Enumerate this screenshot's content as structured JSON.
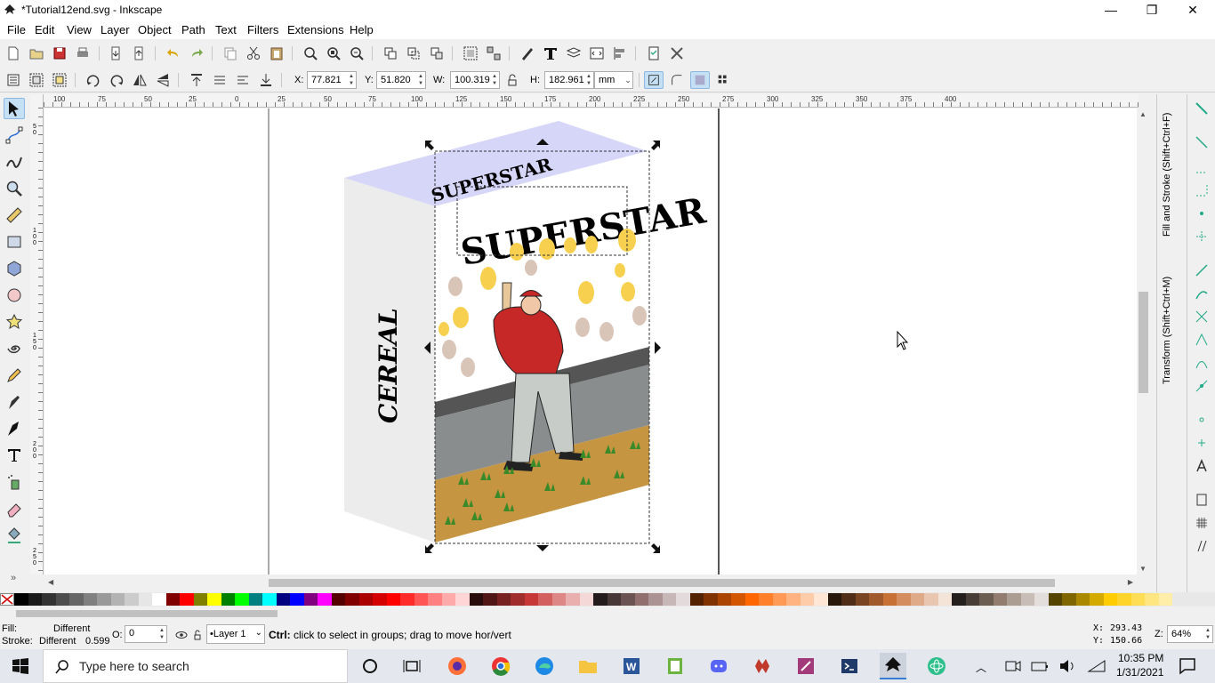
{
  "window": {
    "title": "*Tutorial12end.svg - Inkscape",
    "controls": {
      "minimize": "—",
      "maximize": "❐",
      "close": "✕"
    }
  },
  "menu": [
    "File",
    "Edit",
    "View",
    "Layer",
    "Object",
    "Path",
    "Text",
    "Filters",
    "Extensions",
    "Help"
  ],
  "transform": {
    "x_label": "X:",
    "x": "77.821",
    "y_label": "Y:",
    "y": "51.820",
    "w_label": "W:",
    "w": "100.319",
    "h_label": "H:",
    "h": "182.961",
    "unit": "mm"
  },
  "ruler": {
    "top_labels": [
      "100",
      "75",
      "50",
      "25",
      "0",
      "25",
      "50",
      "75",
      "100",
      "125",
      "150",
      "175",
      "200",
      "225",
      "250",
      "275",
      "300",
      "325",
      "350",
      "375",
      "400"
    ],
    "left_labels": [
      "50",
      "100",
      "150",
      "200",
      "250"
    ]
  },
  "artwork": {
    "box_top_text": "SUPERSTAR",
    "front_title": "SUPERSTAR",
    "side_text": "CEREAL"
  },
  "dock": {
    "fill_stroke_tab": "Fill and Stroke (Shift+Ctrl+F)",
    "transform_tab": "Transform (Shift+Ctrl+M)"
  },
  "palette": {
    "swatches": [
      "#000000",
      "#1a1a1a",
      "#333333",
      "#4d4d4d",
      "#666666",
      "#808080",
      "#999999",
      "#b3b3b3",
      "#cccccc",
      "#e6e6e6",
      "#ffffff",
      "#800000",
      "#ff0000",
      "#808000",
      "#ffff00",
      "#008000",
      "#00ff00",
      "#008080",
      "#00ffff",
      "#000080",
      "#0000ff",
      "#800080",
      "#ff00ff",
      "#550000",
      "#800000",
      "#aa0000",
      "#d40000",
      "#ff0000",
      "#ff2a2a",
      "#ff5555",
      "#ff8080",
      "#ffaaaa",
      "#ffd5d5",
      "#280b0b",
      "#501616",
      "#782121",
      "#a02c2c",
      "#c83737",
      "#d35f5f",
      "#de8787",
      "#e9afaf",
      "#f4d7d7",
      "#241c1c",
      "#483737",
      "#6c5353",
      "#916f6f",
      "#ac9393",
      "#c8b7b7",
      "#e3dbdb",
      "#552200",
      "#803300",
      "#aa4400",
      "#d45500",
      "#ff6600",
      "#ff7f2a",
      "#ff9955",
      "#ffb380",
      "#ffccaa",
      "#ffe6d5",
      "#28170b",
      "#502d16",
      "#784421",
      "#a05a2c",
      "#c87137",
      "#d38d5f",
      "#deaa87",
      "#e9c6af",
      "#f4e3d7",
      "#241f1c",
      "#483e37",
      "#6c5d53",
      "#917c6f",
      "#ac9d93",
      "#c8beb7",
      "#e3dedb",
      "#554400",
      "#806600",
      "#aa8800",
      "#d4aa00",
      "#ffcc00",
      "#ffd42a",
      "#ffdd55",
      "#ffe680",
      "#ffeeaa"
    ]
  },
  "status": {
    "fill_label": "Fill:",
    "fill_value": "Different",
    "stroke_label": "Stroke:",
    "stroke_value": "Different",
    "stroke_width": "0.599",
    "opacity_label": "O:",
    "opacity": "0",
    "layer": "•Layer 1",
    "message_bold": "Ctrl:",
    "message": " click to select in groups; drag to move hor/vert",
    "cursor_x_label": "X:",
    "cursor_x": "293.43",
    "cursor_y_label": "Y:",
    "cursor_y": "150.66",
    "zoom_label": "Z:",
    "zoom": "64%"
  },
  "taskbar": {
    "search_placeholder": "Type here to search",
    "time": "10:35 PM",
    "date": "1/31/2021"
  }
}
